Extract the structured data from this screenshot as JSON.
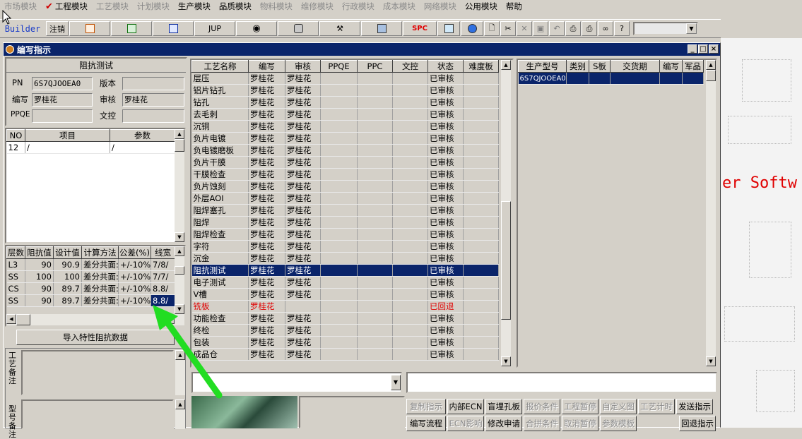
{
  "menubar": {
    "items": [
      {
        "label": "市场模块",
        "enabled": false
      },
      {
        "label": "工程模块",
        "enabled": true,
        "checked": true
      },
      {
        "label": "工艺模块",
        "enabled": false
      },
      {
        "label": "计划模块",
        "enabled": false
      },
      {
        "label": "生产模块",
        "enabled": true
      },
      {
        "label": "品质模块",
        "enabled": true
      },
      {
        "label": "物料模块",
        "enabled": false
      },
      {
        "label": "维修模块",
        "enabled": false
      },
      {
        "label": "行政模块",
        "enabled": false
      },
      {
        "label": "成本模块",
        "enabled": false
      },
      {
        "label": "网络模块",
        "enabled": false
      },
      {
        "label": "公用模块",
        "enabled": true
      },
      {
        "label": "帮助",
        "enabled": true
      }
    ]
  },
  "toolbar": {
    "builder": "Builder",
    "logout": "注销",
    "jup": "JUP",
    "spc": "SPC"
  },
  "window": {
    "title": "编写指示"
  },
  "form": {
    "process_name": "阻抗测试",
    "pn_label": "PN",
    "pn_value": "6S7QJOOEA0",
    "version_label": "版本",
    "version_value": "",
    "writer_label": "编写",
    "writer_value": "罗桂花",
    "reviewer_label": "审核",
    "reviewer_value": "罗桂花",
    "ppqe_label": "PPQE",
    "ppqe_value": "",
    "doc_label": "文控",
    "doc_value": ""
  },
  "params_grid": {
    "headers": [
      "NO",
      "项目",
      "参数"
    ],
    "rows": [
      [
        "12",
        "/",
        "/"
      ]
    ]
  },
  "impedance_grid": {
    "headers": [
      "层数",
      "阻抗值",
      "设计值",
      "计算方法",
      "公差(%)",
      "线宽"
    ],
    "rows": [
      [
        "L3",
        "90",
        "90.9",
        "差分共面:",
        "+/-10%",
        "7/8/"
      ],
      [
        "SS",
        "100",
        "100",
        "差分共面:",
        "+/-10%",
        "7/7/"
      ],
      [
        "CS",
        "90",
        "89.7",
        "差分共面:",
        "+/-10%",
        "8.8/"
      ],
      [
        "SS",
        "90",
        "89.7",
        "差分共面:",
        "+/-10%",
        "8.8/"
      ]
    ]
  },
  "import_button": "导入特性阻抗数据",
  "notes": {
    "process_note_label": "工艺备注",
    "model_note_label": "型号备注"
  },
  "process_grid": {
    "headers": [
      "工艺名称",
      "编写",
      "审核",
      "PPQE",
      "PPC",
      "文控",
      "状态",
      "难度板"
    ],
    "rows": [
      [
        "层压",
        "罗桂花",
        "罗桂花",
        "",
        "",
        "",
        "已审核",
        ""
      ],
      [
        "铝片钻孔",
        "罗桂花",
        "罗桂花",
        "",
        "",
        "",
        "已审核",
        ""
      ],
      [
        "钻孔",
        "罗桂花",
        "罗桂花",
        "",
        "",
        "",
        "已审核",
        ""
      ],
      [
        "去毛刺",
        "罗桂花",
        "罗桂花",
        "",
        "",
        "",
        "已审核",
        ""
      ],
      [
        "沉铜",
        "罗桂花",
        "罗桂花",
        "",
        "",
        "",
        "已审核",
        ""
      ],
      [
        "负片电镀",
        "罗桂花",
        "罗桂花",
        "",
        "",
        "",
        "已审核",
        ""
      ],
      [
        "负电镀磨板",
        "罗桂花",
        "罗桂花",
        "",
        "",
        "",
        "已审核",
        ""
      ],
      [
        "负片干膜",
        "罗桂花",
        "罗桂花",
        "",
        "",
        "",
        "已审核",
        ""
      ],
      [
        "干膜检查",
        "罗桂花",
        "罗桂花",
        "",
        "",
        "",
        "已审核",
        ""
      ],
      [
        "负片蚀刻",
        "罗桂花",
        "罗桂花",
        "",
        "",
        "",
        "已审核",
        ""
      ],
      [
        "外层AOI",
        "罗桂花",
        "罗桂花",
        "",
        "",
        "",
        "已审核",
        ""
      ],
      [
        "阻焊塞孔",
        "罗桂花",
        "罗桂花",
        "",
        "",
        "",
        "已审核",
        ""
      ],
      [
        "阻焊",
        "罗桂花",
        "罗桂花",
        "",
        "",
        "",
        "已审核",
        ""
      ],
      [
        "阻焊检查",
        "罗桂花",
        "罗桂花",
        "",
        "",
        "",
        "已审核",
        ""
      ],
      [
        "字符",
        "罗桂花",
        "罗桂花",
        "",
        "",
        "",
        "已审核",
        ""
      ],
      [
        "沉金",
        "罗桂花",
        "罗桂花",
        "",
        "",
        "",
        "已审核",
        ""
      ],
      [
        "阻抗测试",
        "罗桂花",
        "罗桂花",
        "",
        "",
        "",
        "已审核",
        ""
      ],
      [
        "电子测试",
        "罗桂花",
        "罗桂花",
        "",
        "",
        "",
        "已审核",
        ""
      ],
      [
        "V槽",
        "罗桂花",
        "罗桂花",
        "",
        "",
        "",
        "已审核",
        ""
      ],
      [
        "铣板",
        "罗桂花",
        "",
        "",
        "",
        "",
        "已回退",
        ""
      ],
      [
        "功能检查",
        "罗桂花",
        "罗桂花",
        "",
        "",
        "",
        "已审核",
        ""
      ],
      [
        "终检",
        "罗桂花",
        "罗桂花",
        "",
        "",
        "",
        "已审核",
        ""
      ],
      [
        "包装",
        "罗桂花",
        "罗桂花",
        "",
        "",
        "",
        "已审核",
        ""
      ],
      [
        "成品仓",
        "罗桂花",
        "罗桂花",
        "",
        "",
        "",
        "已审核",
        ""
      ]
    ],
    "selected_index": 16,
    "rejected_index": 19
  },
  "model_grid": {
    "headers": [
      "生产型号",
      "类别",
      "S板",
      "交货期",
      "编写",
      "军品"
    ],
    "rows": [
      [
        "6S7QJOOEA0",
        "",
        "",
        "",
        "",
        ""
      ]
    ]
  },
  "buttons_row1": [
    {
      "label": "复制指示",
      "enabled": false
    },
    {
      "label": "内部ECN",
      "enabled": true
    },
    {
      "label": "盲埋孔板",
      "enabled": true
    },
    {
      "label": "报价条件",
      "enabled": false
    },
    {
      "label": "工程暂停",
      "enabled": false
    },
    {
      "label": "自定义图",
      "enabled": false
    },
    {
      "label": "工艺计时",
      "enabled": false
    },
    {
      "label": "发送指示",
      "enabled": true
    }
  ],
  "buttons_row2": [
    {
      "label": "编写流程",
      "enabled": true
    },
    {
      "label": "ECN影响",
      "enabled": false
    },
    {
      "label": "修改申请",
      "enabled": true
    },
    {
      "label": "合拼条件",
      "enabled": false
    },
    {
      "label": "取消暂停",
      "enabled": false
    },
    {
      "label": "参数模板",
      "enabled": false
    },
    {
      "label": "回退指示",
      "enabled": true
    }
  ],
  "desktop": {
    "text": "er Softw"
  },
  "colors": {
    "title": "#0a246a",
    "selected": "#0a246a",
    "rejected": "#e00000",
    "arrow": "#22dd22"
  }
}
